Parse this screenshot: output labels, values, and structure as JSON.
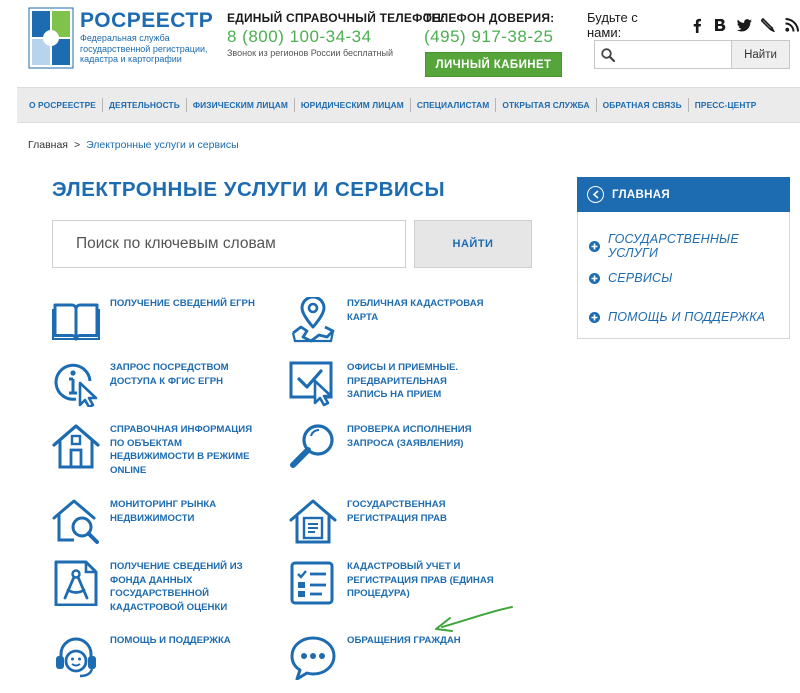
{
  "header": {
    "logo_name": "РОСРЕЕСТР",
    "logo_sub": "Федеральная служба государственной регистрации, кадастра и картографии",
    "phone1_label": "ЕДИНЫЙ СПРАВОЧНЫЙ ТЕЛЕФОН:",
    "phone1_number": "8 (800) 100-34-34",
    "phone1_note": "Звонок из регионов России бесплатный",
    "phone2_label": "ТЕЛЕФОН ДОВЕРИЯ:",
    "phone2_number": "(495) 917-38-25",
    "cabinet_label": "ЛИЧНЫЙ КАБИНЕТ",
    "social_label": "Будьте с нами:",
    "social_icons": [
      "facebook-icon",
      "vk-icon",
      "twitter-icon",
      "livejournal-icon",
      "rss-icon"
    ],
    "search_placeholder": "",
    "search_button": "Найти"
  },
  "nav": {
    "items": [
      "О РОСРЕЕСТРЕ",
      "ДЕЯТЕЛЬНОСТЬ",
      "ФИЗИЧЕСКИМ ЛИЦАМ",
      "ЮРИДИЧЕСКИМ ЛИЦАМ",
      "СПЕЦИАЛИСТАМ",
      "ОТКРЫТАЯ СЛУЖБА",
      "ОБРАТНАЯ СВЯЗЬ",
      "ПРЕСС-ЦЕНТР"
    ]
  },
  "breadcrumb": {
    "home": "Главная",
    "separator": ">",
    "current": "Электронные услуги и сервисы"
  },
  "main": {
    "title": "ЭЛЕКТРОННЫЕ УСЛУГИ И СЕРВИСЫ",
    "search_placeholder": "Поиск по ключевым словам",
    "search_button": "НАЙТИ",
    "services": [
      {
        "label": "ПОЛУЧЕНИЕ СВЕДЕНИЙ ЕГРН",
        "icon": "book-icon"
      },
      {
        "label": "ПУБЛИЧНАЯ КАДАСТРОВАЯ КАРТА",
        "icon": "map-pin-icon"
      },
      {
        "label": "ЗАПРОС ПОСРЕДСТВОМ ДОСТУПА К ФГИС ЕГРН",
        "icon": "info-cursor-icon"
      },
      {
        "label": "ОФИСЫ И ПРИЕМНЫЕ. ПРЕДВАРИТЕЛЬНАЯ ЗАПИСЬ НА ПРИЕМ",
        "icon": "check-window-icon"
      },
      {
        "label": "СПРАВОЧНАЯ ИНФОРМАЦИЯ ПО ОБЪЕКТАМ НЕДВИЖИМОСТИ В РЕЖИМЕ ONLINE",
        "icon": "house-icon"
      },
      {
        "label": "ПРОВЕРКА ИСПОЛНЕНИЯ ЗАПРОСА (ЗАЯВЛЕНИЯ)",
        "icon": "magnifier-icon"
      },
      {
        "label": "МОНИТОРИНГ РЫНКА НЕДВИЖИМОСТИ",
        "icon": "house-search-icon"
      },
      {
        "label": "ГОСУДАРСТВЕННАЯ РЕГИСТРАЦИЯ ПРАВ",
        "icon": "house-document-icon"
      },
      {
        "label": "ПОЛУЧЕНИЕ СВЕДЕНИЙ ИЗ ФОНДА ДАННЫХ ГОСУДАРСТВЕННОЙ КАДАСТРОВОЙ ОЦЕНКИ",
        "icon": "compass-document-icon"
      },
      {
        "label": "КАДАСТРОВЫЙ УЧЕТ И РЕГИСТРАЦИЯ ПРАВ (ЕДИНАЯ ПРОЦЕДУРА)",
        "icon": "checklist-icon"
      },
      {
        "label": "ПОМОЩЬ И ПОДДЕРЖКА",
        "icon": "headset-icon"
      },
      {
        "label": "ОБРАЩЕНИЯ ГРАЖДАН",
        "icon": "chat-bubble-icon"
      }
    ]
  },
  "sidebar": {
    "head": "ГЛАВНАЯ",
    "items": [
      "ГОСУДАРСТВЕННЫЕ УСЛУГИ",
      "СЕРВИСЫ",
      "ПОМОЩЬ И ПОДДЕРЖКА"
    ]
  },
  "colors": {
    "brand_blue": "#1d6bb0",
    "green": "#56a53a",
    "phone_green": "#4caf50",
    "annotation_green": "#3ca63c"
  }
}
